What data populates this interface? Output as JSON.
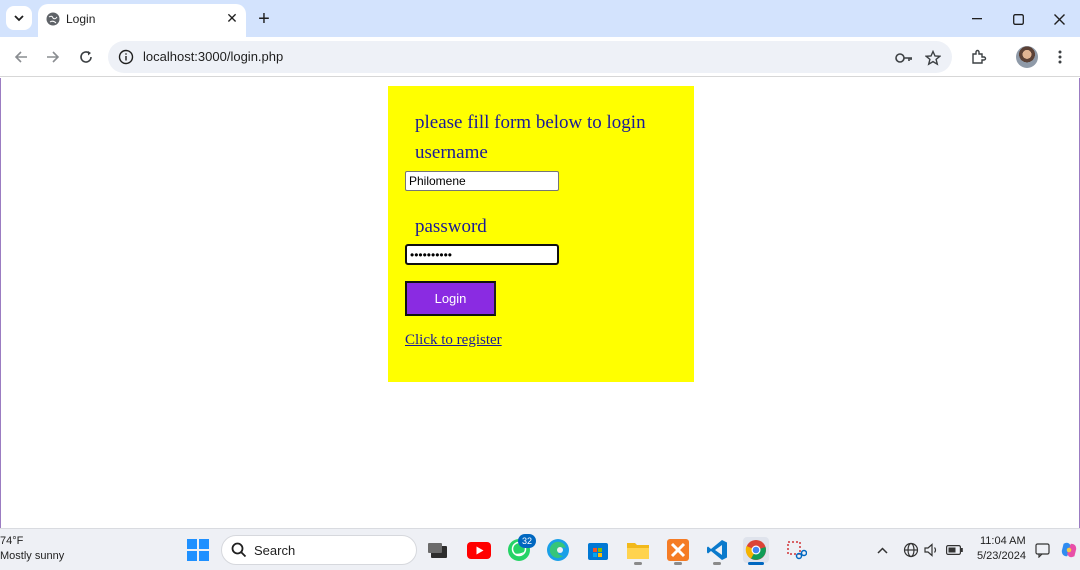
{
  "browser": {
    "tab": {
      "title": "Login"
    },
    "url": "localhost:3000/login.php"
  },
  "form": {
    "heading": "please fill form below to login",
    "username_label": "username",
    "username_value": "Philomene",
    "password_label": "password",
    "password_value": "••••••••••",
    "login_label": "Login",
    "register_link": "Click to register"
  },
  "colors": {
    "form_background": "#ffff00",
    "button": "#8a2be2",
    "text": "#1a1a99"
  },
  "taskbar": {
    "weather_temp": "74°F",
    "weather_desc": "Mostly sunny",
    "search_label": "Search",
    "whatsapp_badge": "32",
    "time": "11:04 AM",
    "date": "5/23/2024"
  }
}
